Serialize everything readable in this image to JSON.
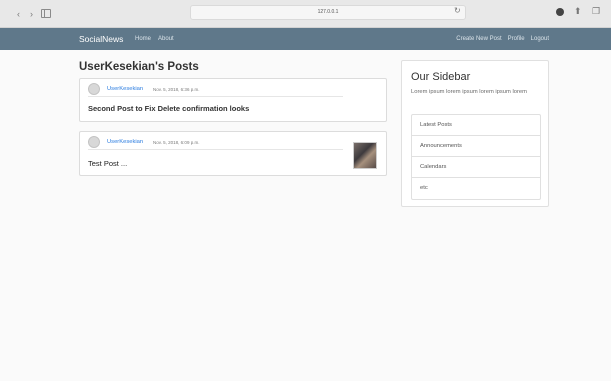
{
  "browser": {
    "address": "127.0.0.1"
  },
  "navbar": {
    "brand": "SocialNews",
    "left_links": [
      "Home",
      "About"
    ],
    "right_links": [
      "Create New Post",
      "Profile",
      "Logout"
    ]
  },
  "main": {
    "title": "UserKesekian's Posts",
    "posts": [
      {
        "author": "UserKesekian",
        "date": "Nov. 5, 2018, 6:36 p.m.",
        "title": "Second Post to Fix Delete confirmation looks"
      },
      {
        "author": "UserKesekian",
        "date": "Nov. 5, 2018, 6:09 p.m.",
        "title": "Test Post ..."
      }
    ]
  },
  "sidebar": {
    "title": "Our Sidebar",
    "text": "Lorem ipsum lorem ipsum lorem ipsum lorem",
    "items": [
      "Latest Posts",
      "Announcements",
      "Calendars",
      "etc"
    ]
  }
}
